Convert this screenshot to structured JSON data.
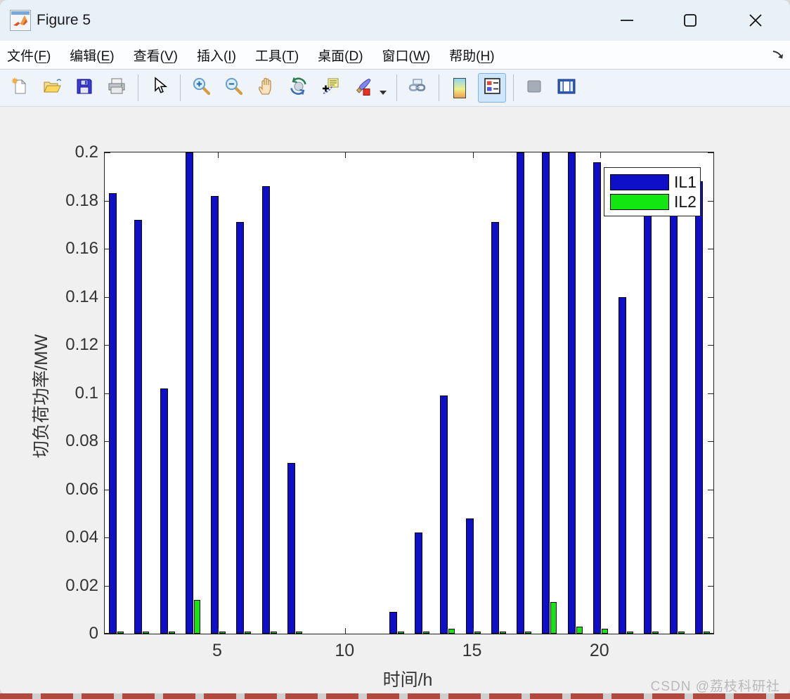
{
  "window": {
    "title": "Figure 5"
  },
  "menu": {
    "items": [
      {
        "text": "文件",
        "mnemonic": "F"
      },
      {
        "text": "编辑",
        "mnemonic": "E"
      },
      {
        "text": "查看",
        "mnemonic": "V"
      },
      {
        "text": "插入",
        "mnemonic": "I"
      },
      {
        "text": "工具",
        "mnemonic": "T"
      },
      {
        "text": "桌面",
        "mnemonic": "D"
      },
      {
        "text": "窗口",
        "mnemonic": "W"
      },
      {
        "text": "帮助",
        "mnemonic": "H"
      }
    ]
  },
  "toolbar": {
    "buttons": [
      {
        "type": "button",
        "name": "new-figure"
      },
      {
        "type": "button",
        "name": "open-file"
      },
      {
        "type": "button",
        "name": "save-figure"
      },
      {
        "type": "button",
        "name": "print-figure"
      },
      {
        "type": "sep"
      },
      {
        "type": "button",
        "name": "edit-plot-pointer"
      },
      {
        "type": "sep"
      },
      {
        "type": "button",
        "name": "zoom-in"
      },
      {
        "type": "button",
        "name": "zoom-out"
      },
      {
        "type": "button",
        "name": "pan"
      },
      {
        "type": "button",
        "name": "rotate-3d"
      },
      {
        "type": "button",
        "name": "data-cursor"
      },
      {
        "type": "button",
        "name": "brush",
        "caret": true
      },
      {
        "type": "sep"
      },
      {
        "type": "button",
        "name": "link-plot"
      },
      {
        "type": "sep"
      },
      {
        "type": "button",
        "name": "insert-colorbar"
      },
      {
        "type": "button",
        "name": "insert-legend",
        "active": true
      },
      {
        "type": "sep"
      },
      {
        "type": "button",
        "name": "hide-plot-tools"
      },
      {
        "type": "button",
        "name": "show-plot-tools"
      }
    ]
  },
  "chart_data": {
    "type": "bar",
    "title": "",
    "xlabel": "时间/h",
    "ylabel": "切负荷功率/MW",
    "xlim": [
      0.5,
      24.5
    ],
    "ylim": [
      0,
      0.2
    ],
    "grid": false,
    "legend_position": "northeast",
    "xticks": [
      5,
      10,
      15,
      20
    ],
    "ytick_labels": [
      "0",
      "0.02",
      "0.04",
      "0.06",
      "0.08",
      "0.1",
      "0.12",
      "0.14",
      "0.16",
      "0.18",
      "0.2"
    ],
    "yticks": [
      0,
      0.02,
      0.04,
      0.06,
      0.08,
      0.1,
      0.12,
      0.14,
      0.16,
      0.18,
      0.2
    ],
    "categories": [
      1,
      2,
      3,
      4,
      5,
      6,
      7,
      8,
      9,
      10,
      11,
      12,
      13,
      14,
      15,
      16,
      17,
      18,
      19,
      20,
      21,
      22,
      23,
      24
    ],
    "series": [
      {
        "name": "IL1",
        "color": "#0f0fc8",
        "values": [
          0.183,
          0.172,
          0.102,
          0.2,
          0.182,
          0.171,
          0.186,
          0.071,
          0,
          0,
          0,
          0.009,
          0.042,
          0.099,
          0.048,
          0.171,
          0.2,
          0.2,
          0.2,
          0.196,
          0.14,
          0.18,
          0.18,
          0.188
        ]
      },
      {
        "name": "IL2",
        "color": "#12e712",
        "values": [
          0.001,
          0.001,
          0.001,
          0.014,
          0.001,
          0.001,
          0.001,
          0.001,
          0,
          0,
          0,
          0.001,
          0.001,
          0.002,
          0.001,
          0.001,
          0.001,
          0.013,
          0.003,
          0.002,
          0.001,
          0.001,
          0.001,
          0.001
        ]
      }
    ]
  },
  "watermark": {
    "text": "CSDN @荔枝科研社"
  }
}
